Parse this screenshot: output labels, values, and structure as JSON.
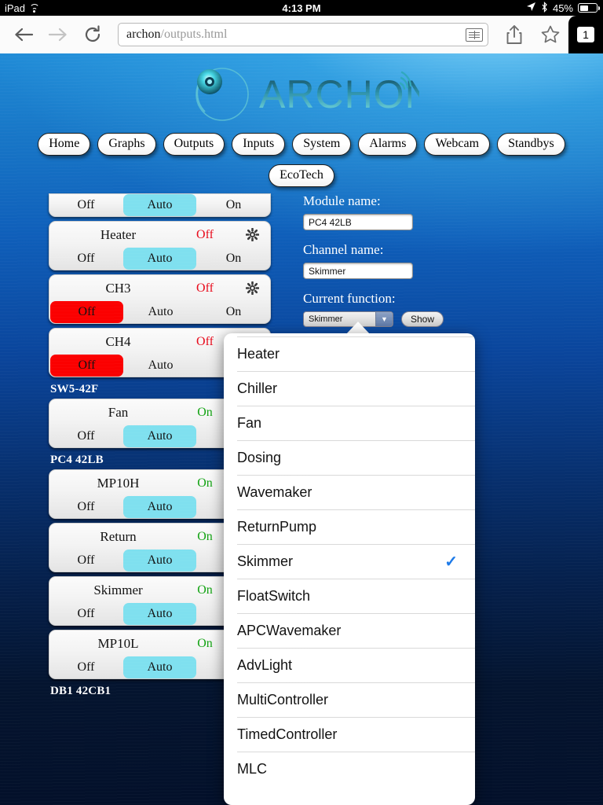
{
  "status_bar": {
    "device": "iPad",
    "wifi_icon": "wifi-icon",
    "time": "4:13 PM",
    "location_icon": "location-arrow-icon",
    "bluetooth_icon": "bluetooth-icon",
    "battery_percent": "45%"
  },
  "browser": {
    "back_icon": "back-arrow-icon",
    "forward_icon": "forward-arrow-icon",
    "reload_icon": "reload-icon",
    "url_host": "archon",
    "url_path": "/outputs.html",
    "reader_icon": "reader-view-icon",
    "share_icon": "share-icon",
    "bookmark_icon": "bookmark-star-icon",
    "tab_count": "1"
  },
  "brand": {
    "name": "ARCHON"
  },
  "nav": {
    "row1": [
      "Home",
      "Graphs",
      "Outputs",
      "Inputs",
      "System",
      "Alarms",
      "Webcam",
      "Standbys"
    ],
    "row2": [
      "EcoTech"
    ]
  },
  "segments": {
    "off": "Off",
    "auto": "Auto",
    "on": "On"
  },
  "outputs": [
    {
      "kind": "card",
      "clipped": true,
      "name": "",
      "state": "",
      "state_class": "",
      "gear": false,
      "selected": "auto"
    },
    {
      "kind": "card",
      "clipped": false,
      "name": "Heater",
      "state": "Off",
      "state_class": "off",
      "gear": true,
      "selected": "auto"
    },
    {
      "kind": "card",
      "clipped": false,
      "name": "CH3",
      "state": "Off",
      "state_class": "off",
      "gear": true,
      "selected": "off"
    },
    {
      "kind": "card",
      "clipped": false,
      "name": "CH4",
      "state": "Off",
      "state_class": "off",
      "gear": true,
      "selected": "off"
    },
    {
      "kind": "group",
      "label": "SW5-42F"
    },
    {
      "kind": "card",
      "clipped": false,
      "name": "Fan",
      "state": "On",
      "state_class": "on",
      "gear": false,
      "selected": "auto"
    },
    {
      "kind": "group",
      "label": "PC4 42LB"
    },
    {
      "kind": "card",
      "clipped": false,
      "name": "MP10H",
      "state": "On",
      "state_class": "on",
      "gear": false,
      "selected": "auto"
    },
    {
      "kind": "card",
      "clipped": false,
      "name": "Return",
      "state": "On",
      "state_class": "on",
      "gear": false,
      "selected": "auto"
    },
    {
      "kind": "card",
      "clipped": false,
      "name": "Skimmer",
      "state": "On",
      "state_class": "on",
      "gear": false,
      "selected": "auto"
    },
    {
      "kind": "card",
      "clipped": false,
      "name": "MP10L",
      "state": "On",
      "state_class": "on",
      "gear": false,
      "selected": "auto"
    },
    {
      "kind": "group",
      "label": "DB1 42CB1"
    }
  ],
  "form": {
    "module_label": "Module name:",
    "module_value": "PC4 42LB",
    "channel_label": "Channel name:",
    "channel_value": "Skimmer",
    "function_label": "Current function:",
    "function_value": "Skimmer",
    "show_button": "Show",
    "dropdown_icon": "chevron-down-icon"
  },
  "dropdown": {
    "checkmark_icon": "checkmark-icon",
    "selected": "Skimmer",
    "items": [
      "Heater",
      "Chiller",
      "Fan",
      "Dosing",
      "Wavemaker",
      "ReturnPump",
      "Skimmer",
      "FloatSwitch",
      "APCWavemaker",
      "AdvLight",
      "MultiController",
      "TimedController",
      "MLC"
    ]
  },
  "colors": {
    "auto_selected": "#7fe0ef",
    "off_selected": "#fb0000",
    "state_on": "#13a313",
    "state_off": "#e8091a",
    "checkmark": "#1b79e8"
  }
}
